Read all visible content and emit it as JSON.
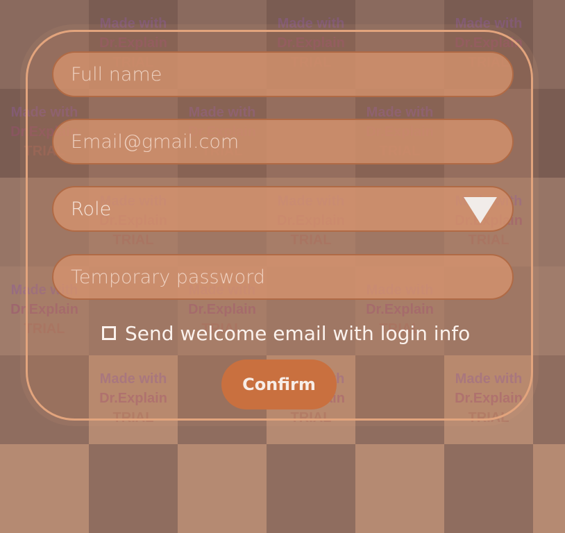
{
  "form": {
    "full_name": {
      "placeholder": "Full name",
      "value": ""
    },
    "email": {
      "placeholder": "Email@gmail.com",
      "value": ""
    },
    "role": {
      "selected": "Role"
    },
    "temp_password": {
      "placeholder": "Temporary password",
      "value": ""
    },
    "send_welcome": {
      "label": "Send welcome email with login info",
      "checked": false
    },
    "confirm_label": "Confirm"
  },
  "watermark": {
    "line1": "Made with",
    "line2": "Dr.Explain",
    "line3": "TRIAL"
  },
  "colors": {
    "panel_border": "#e2a47d",
    "field_fill": "#d6946e",
    "field_border": "#b06a45",
    "button_fill": "#c9703f",
    "text_light": "#fbf2ed"
  }
}
